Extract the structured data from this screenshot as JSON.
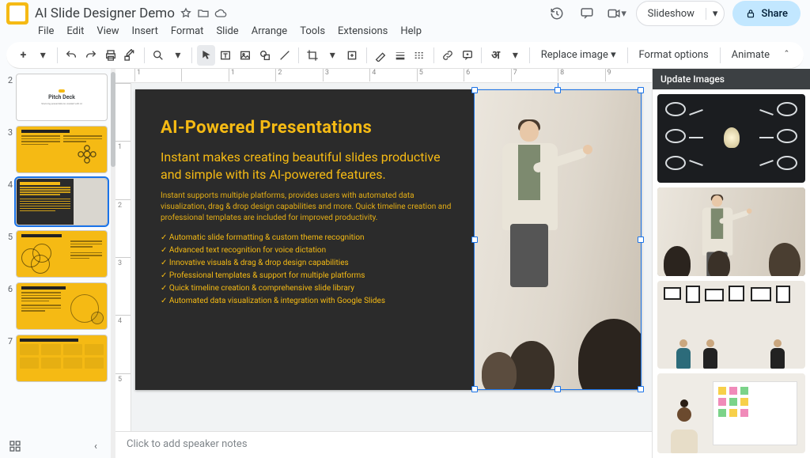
{
  "doc": {
    "title": "AI Slide Designer Demo"
  },
  "menu": {
    "file": "File",
    "edit": "Edit",
    "view": "View",
    "insert": "Insert",
    "format": "Format",
    "slide": "Slide",
    "arrange": "Arrange",
    "tools": "Tools",
    "extensions": "Extensions",
    "help": "Help"
  },
  "header_actions": {
    "slideshow": "Slideshow",
    "share": "Share"
  },
  "toolbar": {
    "replace_image": "Replace image",
    "format_options": "Format options",
    "animate": "Animate"
  },
  "ruler": {
    "h": [
      "1",
      "",
      "1",
      "2",
      "3",
      "4",
      "5",
      "6",
      "7",
      "8",
      "9"
    ],
    "v": [
      "",
      "1",
      "2",
      "3",
      "4",
      "5"
    ]
  },
  "slides": {
    "numbers": [
      "2",
      "3",
      "4",
      "5",
      "6",
      "7"
    ],
    "active_index": 2,
    "thumb2": {
      "title": "Pitch Deck",
      "subtitle": "Stunning presentations created with AI"
    }
  },
  "current_slide": {
    "title": "AI-Powered Presentations",
    "subtitle": "Instant makes creating beautiful slides productive and simple with its AI-powered features.",
    "body": "Instant supports multiple platforms, provides users with automated data visualization, drag & drop design capabilities and more. Quick timeline creation and professional templates are included for improved productivity.",
    "bullets": [
      "Automatic slide formatting & custom theme recognition",
      "Advanced text recognition for voice dictation",
      "Innovative visuals & drag & drop design capabilities",
      "Professional templates & support for multiple platforms",
      "Quick timeline creation & comprehensive slide library",
      "Automated data visualization & integration with Google Slides"
    ]
  },
  "notes": {
    "placeholder": "Click to add speaker notes"
  },
  "sidepanel": {
    "title": "Update Images"
  }
}
